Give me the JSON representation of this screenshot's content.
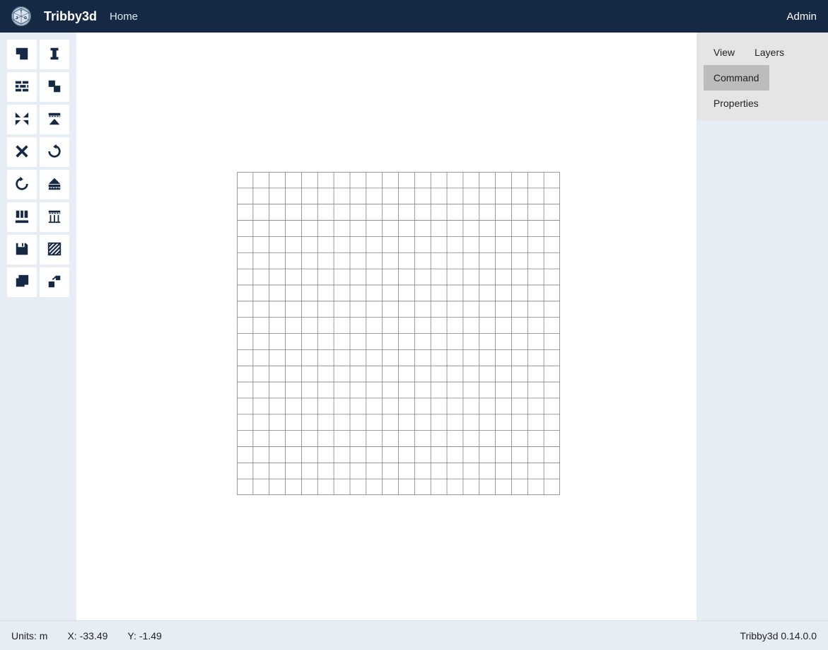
{
  "header": {
    "app_title": "Tribby3d",
    "home_link": "Home",
    "admin_link": "Admin"
  },
  "toolbar": {
    "tools": [
      {
        "name": "slab-tool"
      },
      {
        "name": "column-tool"
      },
      {
        "name": "wall-tool"
      },
      {
        "name": "opening-tool"
      },
      {
        "name": "trim-tool"
      },
      {
        "name": "linesupport-tool"
      },
      {
        "name": "close-tool"
      },
      {
        "name": "undo-tool"
      },
      {
        "name": "redo-tool"
      },
      {
        "name": "pointload-tool"
      },
      {
        "name": "lineload-tool"
      },
      {
        "name": "areaload-tool"
      },
      {
        "name": "save-tool"
      },
      {
        "name": "hatch-tool"
      },
      {
        "name": "copy-tool"
      },
      {
        "name": "move-tool"
      }
    ]
  },
  "right_panel": {
    "tabs": [
      {
        "label": "View",
        "active": false
      },
      {
        "label": "Layers",
        "active": false
      },
      {
        "label": "Command",
        "active": true
      },
      {
        "label": "Properties",
        "active": false
      }
    ]
  },
  "statusbar": {
    "units_label": "Units:",
    "units_value": "m",
    "x_label": "X:",
    "x_value": "-33.49",
    "y_label": "Y:",
    "y_value": "-1.49",
    "version_label": "Tribby3d 0.14.0.0"
  }
}
